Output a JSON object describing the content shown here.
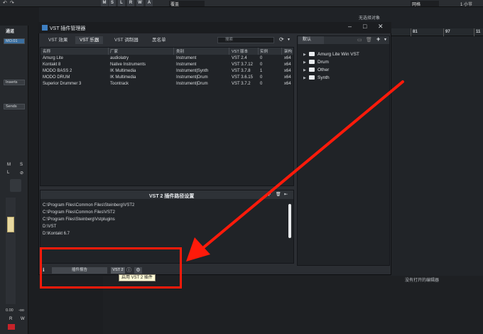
{
  "daw": {
    "toolbar_buttons": [
      "M",
      "S",
      "L",
      "R",
      "W",
      "A"
    ],
    "toolbar_field": "覆盖",
    "toolbar_right": "网格",
    "toolbar_far_right": "1 小节",
    "select_hint": "无选择对象",
    "ruler_numbers": [
      "81",
      "97",
      "11"
    ],
    "no_editor": "没有打开的编辑器"
  },
  "inspector": {
    "title": "通道",
    "channel": "MO.01",
    "inserts": "Inserts",
    "sends": "Sends",
    "ms": [
      "M",
      "S"
    ],
    "lw": [
      "L",
      "⊘"
    ],
    "readout": "0.00",
    "readout2": "-oo",
    "rw": [
      "R",
      "W"
    ]
  },
  "plugin_manager": {
    "title": "VST 插件管理器",
    "tabs": [
      "VST 效果",
      "VST 乐器",
      "VST 调制器",
      "黑名单"
    ],
    "active_tab": 1,
    "search_placeholder": "搜索",
    "columns": [
      "名称",
      "厂家",
      "类别",
      "VST 版本",
      "实例",
      "架构"
    ],
    "rows": [
      [
        "Amurg Lite",
        "audiolatry",
        "Instrument",
        "VST 2.4",
        "0",
        "x64"
      ],
      [
        "Kontakt 8",
        "Native Instruments",
        "Instrument",
        "VST 3.7.12",
        "0",
        "x64"
      ],
      [
        "MODO BASS 2",
        "IK Multimedia",
        "Instrument|Synth",
        "VST 3.7.8",
        "1",
        "x64"
      ],
      [
        "MODO DRUM",
        "IK Multimedia",
        "Instrument|Drum",
        "VST 3.6.15",
        "0",
        "x64"
      ],
      [
        "Superior Drummer 3",
        "Toontrack",
        "Instrument|Drum",
        "VST 3.7.2",
        "0",
        "x64"
      ]
    ],
    "folder_tab": "默认",
    "folders": [
      {
        "name": "Amurg Lite Win VST"
      },
      {
        "name": "Drum"
      },
      {
        "name": "Other"
      },
      {
        "name": "Synth"
      }
    ],
    "path_panel_title": "VST 2 插件路径设置",
    "paths": [
      "C:\\Program Files\\Common Files\\Steinberg\\VST2",
      "C:\\Program Files\\Common Files\\VST2",
      "C:\\Program Files\\Steinberg\\Vstplugins",
      "D:\\VST",
      "D:\\Kontakt 6.7"
    ],
    "report_button": "插件报告",
    "vst2_button": "VST 2",
    "tooltip": "启用 VST 2 插件"
  },
  "colors": {
    "annotation": "#ff1a0a",
    "accent": "#3e7fc1"
  }
}
